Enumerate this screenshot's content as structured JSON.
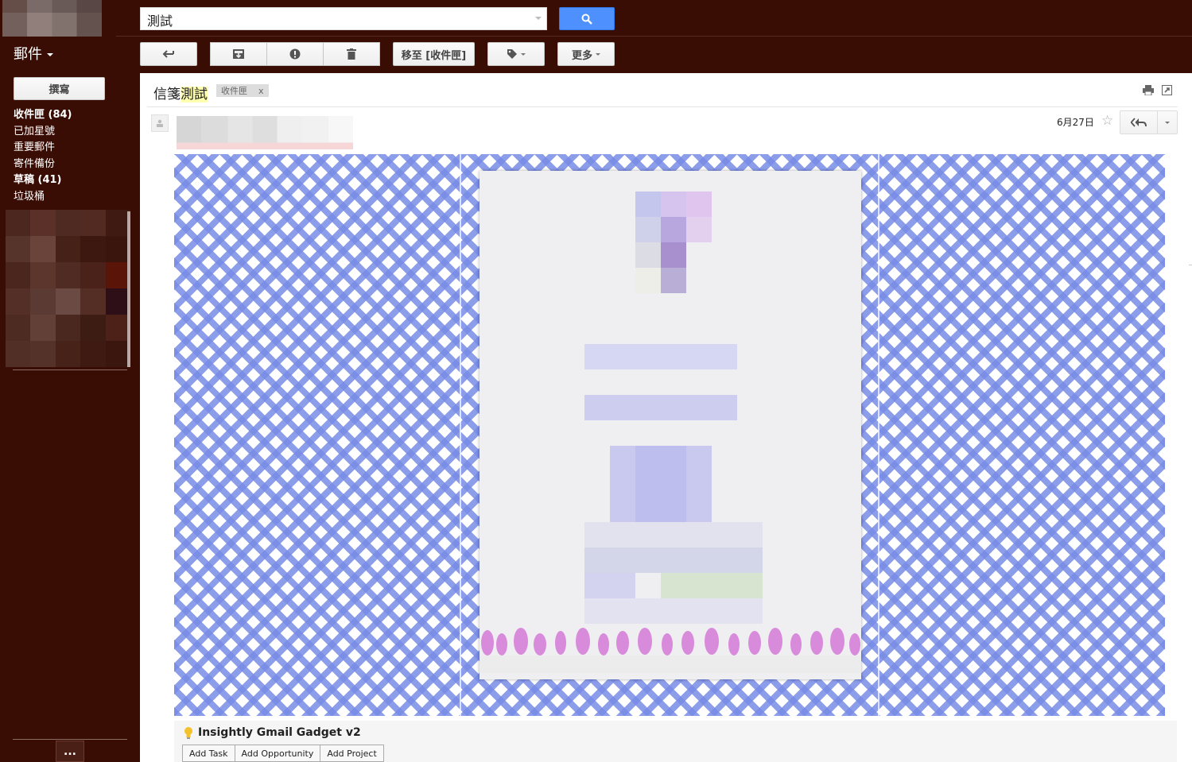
{
  "search": {
    "value": "測試"
  },
  "app": {
    "mail_label": "郵件"
  },
  "toolbar": {
    "move_to_label": "移至 [收件匣]",
    "more_label": "更多"
  },
  "sidebar": {
    "compose_label": "撰寫",
    "items": [
      {
        "label": "收件匣 (84)",
        "bold": true
      },
      {
        "label": "已加星號",
        "bold": false
      },
      {
        "label": "重要郵件",
        "bold": false
      },
      {
        "label": "寄件備份",
        "bold": false
      },
      {
        "label": "草稿 (41)",
        "bold": true
      },
      {
        "label": "垃圾桶",
        "bold": false
      }
    ],
    "more_label": "..."
  },
  "message": {
    "subject_prefix": "信箋",
    "subject_highlight": "測試",
    "label_chip": "收件匣",
    "chip_close": "x",
    "date": "6月27日"
  },
  "gadget": {
    "title": "Insightly Gmail Gadget v2",
    "buttons": [
      "Add Task",
      "Add Opportunity",
      "Add Project"
    ]
  },
  "colors": {
    "chrome_bg": "#3a0d04",
    "search_button": "#4d90fe",
    "subject_highlight": "#ffffb0",
    "stationery_check": "#788ce6"
  },
  "icons": [
    "search-icon",
    "back-arrow-icon",
    "archive-icon",
    "report-spam-icon",
    "trash-icon",
    "tag-icon",
    "print-icon",
    "new-window-icon",
    "avatar-icon",
    "star-icon",
    "reply-all-icon",
    "lightbulb-icon"
  ]
}
